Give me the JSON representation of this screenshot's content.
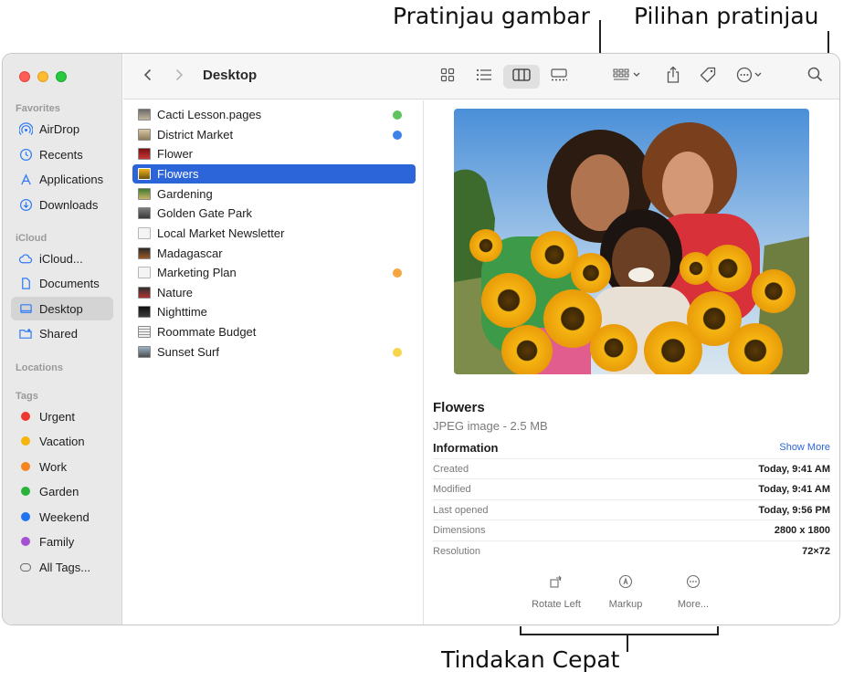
{
  "callouts": {
    "preview_image": "Pratinjau gambar",
    "preview_options": "Pilihan pratinjau",
    "quick_actions": "Tindakan Cepat"
  },
  "toolbar": {
    "title": "Desktop",
    "icons": [
      "chevron-left-icon",
      "chevron-right-icon",
      "icon-view-icon",
      "list-view-icon",
      "column-view-icon",
      "gallery-view-icon",
      "group-icon",
      "share-icon",
      "tag-icon",
      "more-icon",
      "search-icon"
    ]
  },
  "sidebar": {
    "favorites_header": "Favorites",
    "favorites": [
      {
        "label": "AirDrop",
        "icon": "airdrop-icon"
      },
      {
        "label": "Recents",
        "icon": "clock-icon"
      },
      {
        "label": "Applications",
        "icon": "applications-icon"
      },
      {
        "label": "Downloads",
        "icon": "download-icon"
      }
    ],
    "icloud_header": "iCloud",
    "icloud": [
      {
        "label": "iCloud...",
        "icon": "cloud-icon"
      },
      {
        "label": "Documents",
        "icon": "document-icon"
      },
      {
        "label": "Desktop",
        "icon": "desktop-icon",
        "selected": true
      },
      {
        "label": "Shared",
        "icon": "shared-folder-icon"
      }
    ],
    "locations_header": "Locations",
    "tags_header": "Tags",
    "tags": [
      {
        "label": "Urgent",
        "color": "#f0372f"
      },
      {
        "label": "Vacation",
        "color": "#f5b50c"
      },
      {
        "label": "Work",
        "color": "#f48520"
      },
      {
        "label": "Garden",
        "color": "#28b43a"
      },
      {
        "label": "Weekend",
        "color": "#1f74f0"
      },
      {
        "label": "Family",
        "color": "#a54fd3"
      },
      {
        "label": "All Tags..."
      }
    ]
  },
  "files": [
    {
      "name": "Cacti Lesson.pages",
      "tag": "#5fc35b"
    },
    {
      "name": "District Market",
      "tag": "#3d82e8"
    },
    {
      "name": "Flower"
    },
    {
      "name": "Flowers",
      "selected": true
    },
    {
      "name": "Gardening"
    },
    {
      "name": "Golden Gate Park"
    },
    {
      "name": "Local Market Newsletter"
    },
    {
      "name": "Madagascar"
    },
    {
      "name": "Marketing Plan",
      "tag": "#f5a640"
    },
    {
      "name": "Nature"
    },
    {
      "name": "Nighttime"
    },
    {
      "name": "Roommate Budget"
    },
    {
      "name": "Sunset Surf",
      "tag": "#f7d54a"
    }
  ],
  "preview": {
    "name": "Flowers",
    "kind": "JPEG image - 2.5 MB",
    "info_header": "Information",
    "show_more": "Show More",
    "info": [
      {
        "key": "Created",
        "value": "Today, 9:41 AM"
      },
      {
        "key": "Modified",
        "value": "Today, 9:41 AM"
      },
      {
        "key": "Last opened",
        "value": "Today, 9:56 PM"
      },
      {
        "key": "Dimensions",
        "value": "2800 x 1800"
      },
      {
        "key": "Resolution",
        "value": "72×72"
      }
    ],
    "quick_actions": [
      {
        "label": "Rotate Left",
        "icon": "rotate-left-icon"
      },
      {
        "label": "Markup",
        "icon": "markup-icon"
      },
      {
        "label": "More...",
        "icon": "more-icon"
      }
    ]
  }
}
